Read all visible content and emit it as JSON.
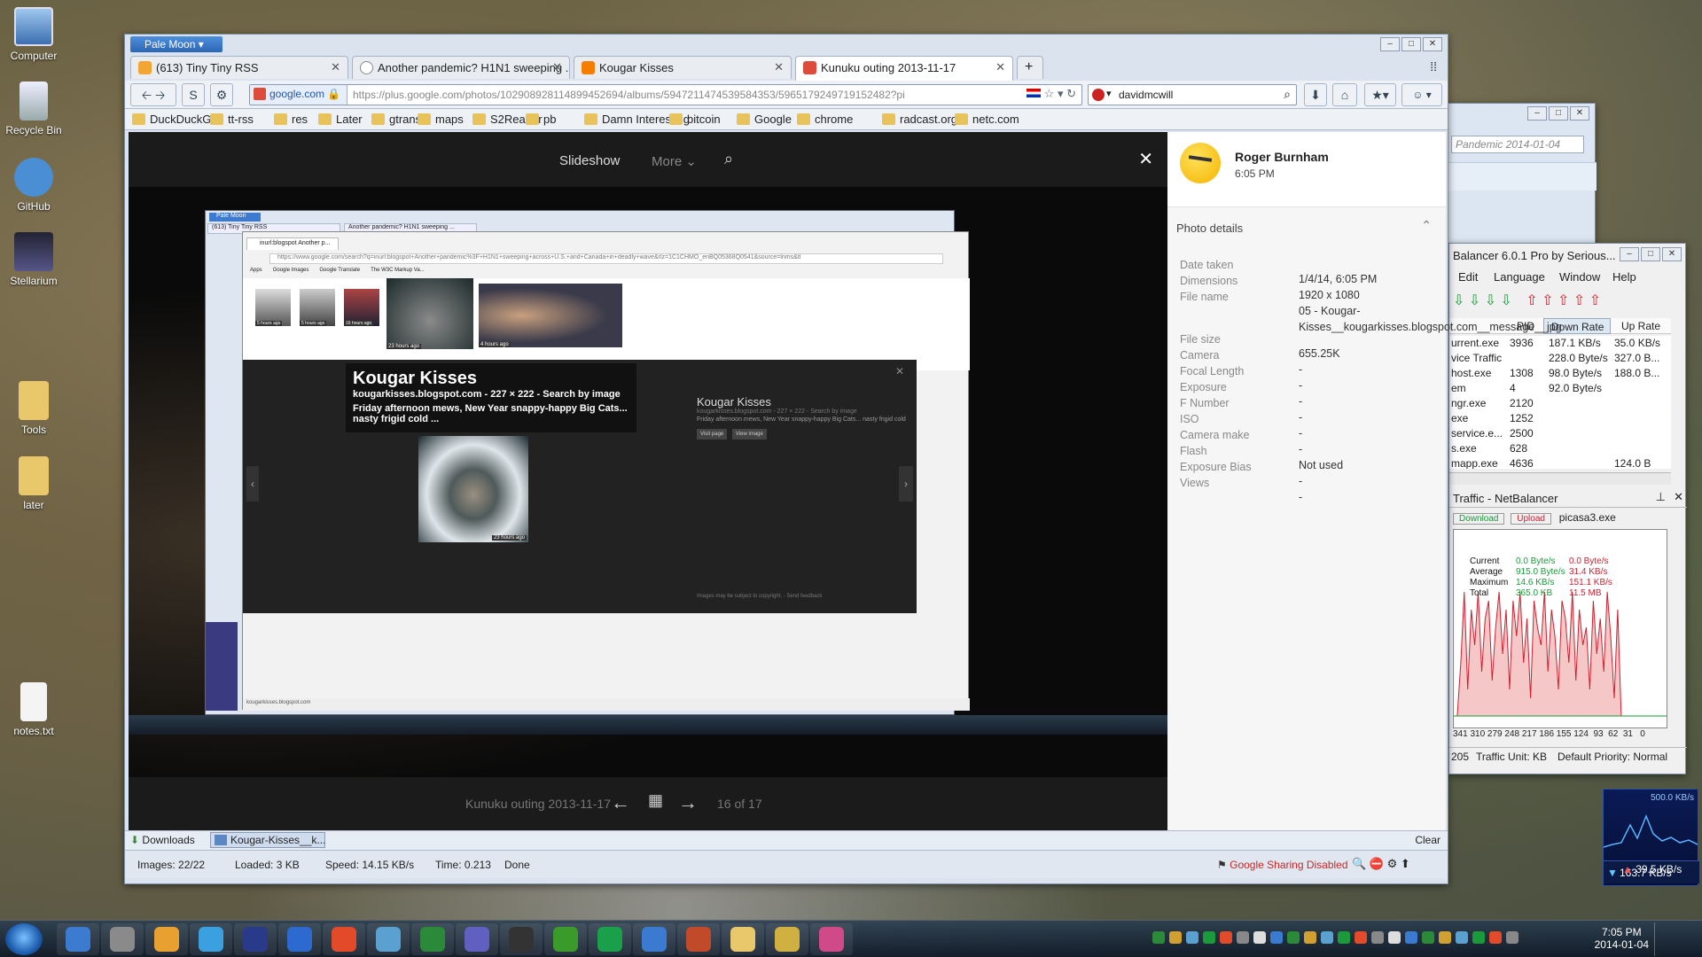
{
  "desktop": {
    "icons": [
      {
        "label": "Computer"
      },
      {
        "label": "Recycle Bin"
      },
      {
        "label": "GitHub"
      },
      {
        "label": "Stellarium"
      },
      {
        "label": "Tools"
      },
      {
        "label": "later"
      },
      {
        "label": "notes.txt"
      }
    ]
  },
  "browser": {
    "menu_button": "Pale Moon",
    "tabs": [
      {
        "label": "(613) Tiny Tiny RSS"
      },
      {
        "label": "Another pandemic? H1N1 sweeping ..."
      },
      {
        "label": "Kougar Kisses"
      },
      {
        "label": "Kunuku outing 2013-11-17"
      }
    ],
    "site_identity": "google.com",
    "url": "https://plus.google.com/photos/102908928114899452694/albums/5947211474539584353/5965179249719152482?pi",
    "search_value": "davidmcwill",
    "bookmarks": [
      "DuckDuckGo",
      "tt-rss",
      "res",
      "Later",
      "gtrans",
      "maps",
      "S2Reader",
      "pb",
      "Damn Interesting",
      "bitcoin",
      "Google",
      "chrome",
      "radcast.org",
      "netc.com"
    ],
    "downloads_label": "Downloads",
    "download_item": "Kougar-Kisses__k...",
    "clear_label": "Clear",
    "status": {
      "images": "Images: 22/22",
      "loaded": "Loaded: 3 KB",
      "speed": "Speed: 14.15 KB/s",
      "time": "Time: 0.213",
      "done": "Done",
      "sharing": "Google Sharing Disabled"
    }
  },
  "photo_viewer": {
    "slideshow": "Slideshow",
    "more": "More",
    "album_title": "Kunuku outing 2013-11-17",
    "counter": "16 of 17"
  },
  "inner_screenshot": {
    "tab_label": "inurl:blogspot Another p...",
    "url": "https://www.google.com/search?q=inurl:blogspot+Another+pandemic%3F+H1N1+sweeping+across+U.S.+and+Canada+in+deadly+wave&rlz=1C1CHMO_enBQ05368Q0541&source=lnms&tl",
    "bookmarks": [
      "Apps",
      "Google Images",
      "Google Translate",
      "The W3C Markup Va..."
    ],
    "thumbs": [
      "5 hours ago",
      "5 hours ago",
      "16 hours ago",
      "23 hours ago",
      "4 hours ago"
    ],
    "card_title": "Kougar Kisses",
    "card_source": "kougarkisses.blogspot.com - 227 × 222 - Search by image",
    "card_desc": "Friday afternoon mews, New Year snappy-happy Big Cats... nasty frigid cold ...",
    "main_caption": "23 hours ago",
    "side_title": "Kougar Kisses",
    "side_source": "kougarkisses.blogspot.com - 227 × 222 - Search by image",
    "side_desc": "Friday afternoon mews, New Year snappy-happy Big Cats... nasty frigid cold",
    "visit": "Visit page",
    "view": "View image",
    "footer": "Images may be subject to copyright.  -  Send feedback",
    "status": "kougarkisses.blogspot.com"
  },
  "photo_panel": {
    "author": "Roger Burnham",
    "time": "6:05 PM",
    "details_title": "Photo details",
    "rows": [
      {
        "k": "Date taken",
        "v": "1/4/14, 6:05 PM"
      },
      {
        "k": "Dimensions",
        "v": "1920 x 1080"
      },
      {
        "k": "File name",
        "v": "05 - Kougar-Kisses__kougarkisses.blogspot.com__message__jpg"
      },
      {
        "k": "File size",
        "v": "655.25K"
      },
      {
        "k": "Camera",
        "v": "-"
      },
      {
        "k": "Focal Length",
        "v": "-"
      },
      {
        "k": "Exposure",
        "v": "-"
      },
      {
        "k": "F Number",
        "v": "-"
      },
      {
        "k": "ISO",
        "v": "-"
      },
      {
        "k": "Camera make",
        "v": "-"
      },
      {
        "k": "Flash",
        "v": "Not used"
      },
      {
        "k": "Exposure Bias",
        "v": "-"
      },
      {
        "k": "Views",
        "v": "-"
      }
    ]
  },
  "back_window": {
    "search_text": "Pandemic 2014-01-04"
  },
  "netbalancer": {
    "title": "Balancer 6.0.1 Pro by Serious...",
    "menu": [
      "Edit",
      "Language",
      "Window",
      "Help"
    ],
    "columns": [
      "PID",
      "Down Rate",
      "Up Rate"
    ],
    "rows": [
      {
        "name": "urrent.exe",
        "pid": "3936",
        "down": "187.1 KB/s",
        "up": "35.0 KB/s"
      },
      {
        "name": "vice Traffic",
        "pid": "",
        "down": "228.0 Byte/s",
        "up": "327.0 B..."
      },
      {
        "name": "host.exe",
        "pid": "1308",
        "down": "98.0 Byte/s",
        "up": "188.0 B..."
      },
      {
        "name": "em",
        "pid": "4",
        "down": "92.0 Byte/s",
        "up": ""
      },
      {
        "name": "ngr.exe",
        "pid": "2120",
        "down": "",
        "up": ""
      },
      {
        "name": "exe",
        "pid": "1252",
        "down": "",
        "up": ""
      },
      {
        "name": "service.e...",
        "pid": "2500",
        "down": "",
        "up": ""
      },
      {
        "name": "s.exe",
        "pid": "628",
        "down": "",
        "up": ""
      },
      {
        "name": "mapp.exe",
        "pid": "4636",
        "down": "",
        "up": "124.0 B"
      }
    ],
    "traffic_title": "Traffic - NetBalancer",
    "legend_download": "Download",
    "legend_upload": "Upload",
    "process": "picasa3.exe",
    "stats": [
      {
        "k": "Current",
        "d": "0.0 Byte/s",
        "u": "0.0 Byte/s"
      },
      {
        "k": "Average",
        "d": "915.0 Byte/s",
        "u": "31.4 KB/s"
      },
      {
        "k": "Maximum",
        "d": "14.6 KB/s",
        "u": "151.1 KB/s"
      },
      {
        "k": "Total",
        "d": "365.0 KB",
        "u": "11.5 MB"
      }
    ],
    "axis": "341 310 279 248 217 186 155 124  93  62  31   0",
    "status_num": "205",
    "unit": "Traffic Unit: KB",
    "priority": "Default Priority: Normal",
    "graph_down_values": [
      0,
      0,
      6,
      14,
      3,
      12,
      8,
      14,
      5,
      11,
      13,
      4,
      10,
      14,
      7,
      12,
      3,
      13,
      9,
      14,
      6,
      11,
      2,
      13,
      10,
      8,
      14,
      5,
      12,
      9,
      3,
      13,
      11,
      6,
      14,
      4,
      12,
      8,
      10,
      3,
      13,
      7,
      11,
      5,
      14,
      9,
      2,
      12,
      0,
      0,
      0,
      0,
      0,
      0,
      0,
      0,
      0,
      0,
      0,
      0,
      0,
      0
    ],
    "graph_max": 15
  },
  "meter": {
    "peak": "500.0 KB/s",
    "down": "163.7 KB/s",
    "up": "39.5 KB/s"
  },
  "taskbar": {
    "time": "7:05 PM",
    "date": "2014-01-04"
  }
}
